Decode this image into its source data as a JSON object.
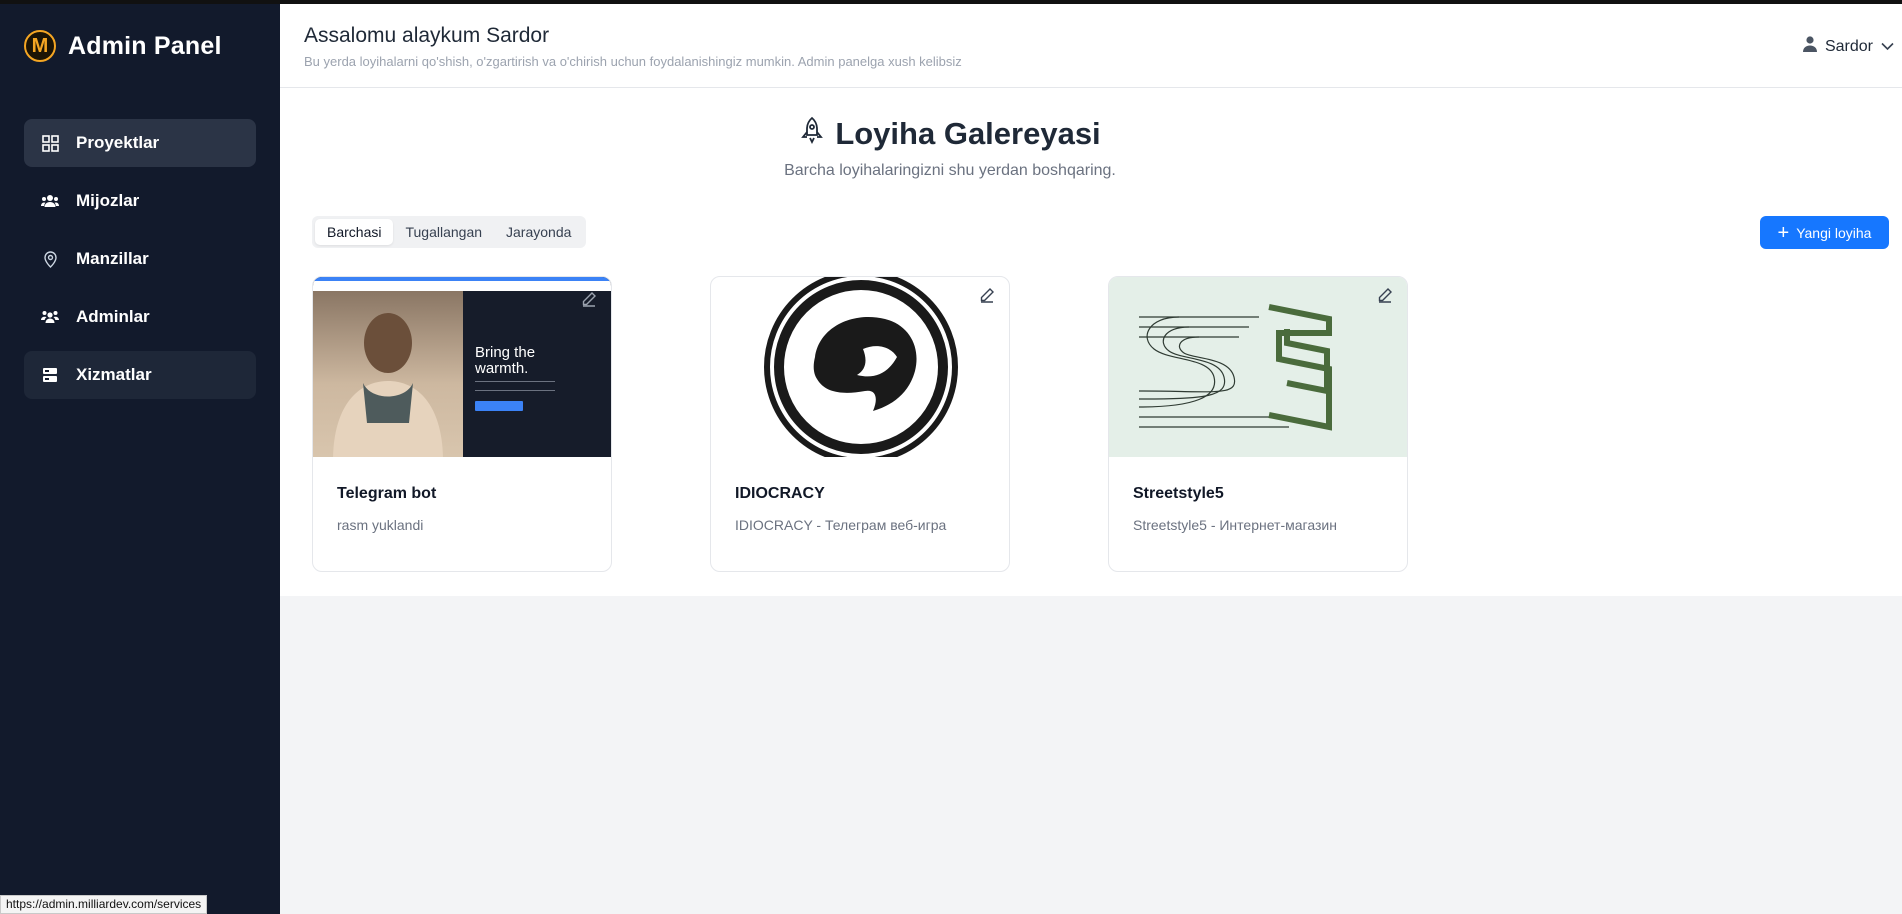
{
  "sidebar": {
    "brand_letter": "M",
    "brand_title": "Admin Panel",
    "items": [
      {
        "label": "Proyektlar",
        "icon": "grid-icon"
      },
      {
        "label": "Mijozlar",
        "icon": "users-icon"
      },
      {
        "label": "Manzillar",
        "icon": "location-pin-icon"
      },
      {
        "label": "Adminlar",
        "icon": "team-icon"
      },
      {
        "label": "Xizmatlar",
        "icon": "services-icon"
      }
    ]
  },
  "header": {
    "greeting": "Assalomu alaykum Sardor",
    "subtext": "Bu yerda loyihalarni qo'shish, o'zgartirish va o'chirish uchun foydalanishingiz mumkin. Admin panelga xush kelibsiz",
    "user_name": "Sardor"
  },
  "gallery": {
    "title": "Loyiha Galereyasi",
    "subtitle": "Barcha loyihalaringizni shu yerdan boshqaring.",
    "filters": [
      "Barchasi",
      "Tugallangan",
      "Jarayonda"
    ],
    "active_filter": "Barchasi",
    "new_button": "Yangi loyiha"
  },
  "projects": [
    {
      "title": "Telegram bot",
      "description": "rasm yuklandi",
      "image_text": "Bring the warmth."
    },
    {
      "title": "IDIOCRACY",
      "description": "IDIOCRACY - Телеграм веб-игра"
    },
    {
      "title": "Streetstyle5",
      "description": "Streetstyle5 - Интернет-магазин"
    }
  ],
  "status_url": "https://admin.milliardev.com/services",
  "colors": {
    "sidebar_bg": "#121a2c",
    "accent": "#1677ff",
    "brand": "#f5a623"
  }
}
